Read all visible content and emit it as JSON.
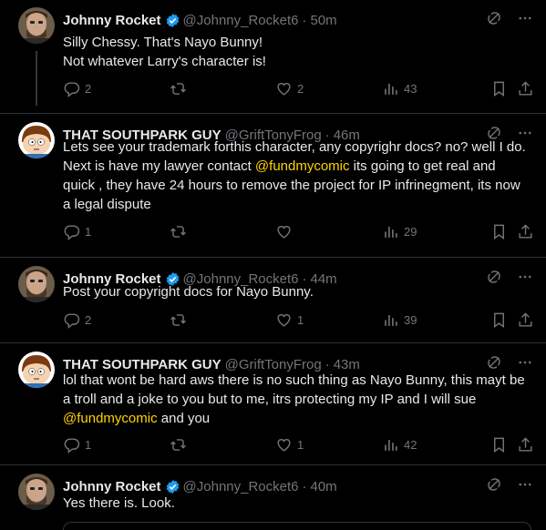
{
  "tweets": [
    {
      "name": "Johnny Rocket",
      "verified": true,
      "handle": "@Johnny_Rocket6",
      "time": "50m",
      "lines": [
        "Silly Chessy. That's Nayo Bunny!",
        "Not whatever Larry's character is!"
      ],
      "replies": "2",
      "retweets": "",
      "likes": "2",
      "views": "43"
    },
    {
      "name": "THAT SOUTHPARK GUY",
      "verified": false,
      "handle": "@GriftTonyFrog",
      "time": "46m",
      "text_before": "Lets see your trademark forthis character, any copyrighr docs? no? well I do. Next is have my lawyer contact ",
      "mention": "@fundmycomic",
      "text_after": " its going to get real and quick , they have 24 hours to remove the project for IP infrinegment, its now a legal dispute",
      "replies": "1",
      "retweets": "",
      "likes": "",
      "views": "29"
    },
    {
      "name": "Johnny Rocket",
      "verified": true,
      "handle": "@Johnny_Rocket6",
      "time": "44m",
      "lines": [
        "Post your copyright docs for Nayo Bunny."
      ],
      "replies": "2",
      "retweets": "",
      "likes": "1",
      "views": "39"
    },
    {
      "name": "THAT SOUTHPARK GUY",
      "verified": false,
      "handle": "@GriftTonyFrog",
      "time": "43m",
      "text_before": "lol that wont be hard aws there is no such thing as Nayo Bunny, this mayt be a troll and a joke to you but to me, itrs protecting my IP and I will sue ",
      "mention": "@fundmycomic",
      "text_after": " and you",
      "replies": "1",
      "retweets": "",
      "likes": "1",
      "views": "42"
    },
    {
      "name": "Johnny Rocket",
      "verified": true,
      "handle": "@Johnny_Rocket6",
      "time": "40m",
      "lines": [
        "Yes there is. Look."
      ]
    }
  ],
  "colors": {
    "accent": "#1d9bf0",
    "mention": "#ffd400",
    "muted": "#71767b",
    "text": "#e7e9ea"
  },
  "icons": [
    "grok-icon",
    "more-icon",
    "reply-icon",
    "retweet-icon",
    "like-icon",
    "views-icon",
    "bookmark-icon",
    "share-icon",
    "verified-icon"
  ]
}
